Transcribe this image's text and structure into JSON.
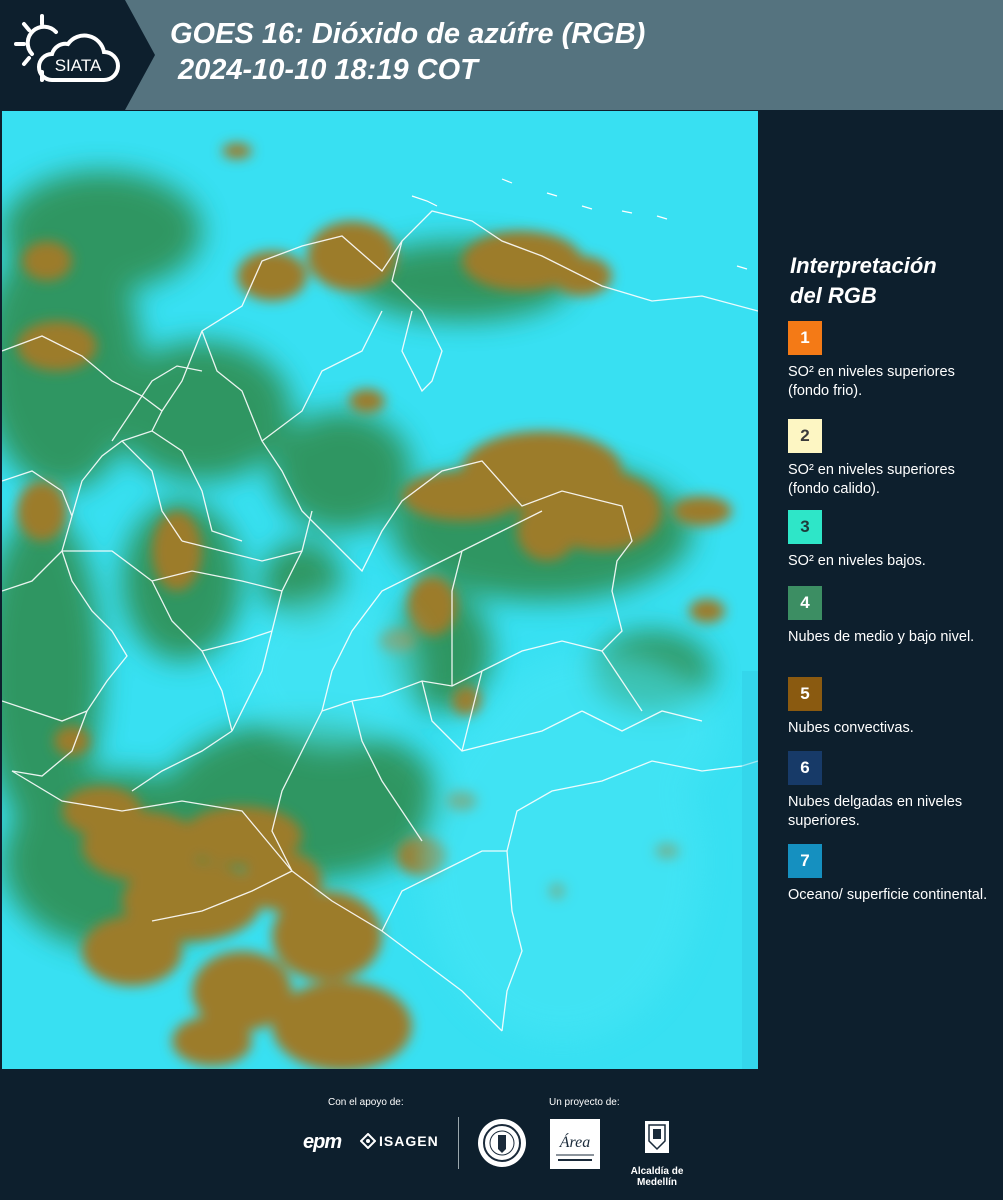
{
  "header": {
    "logo_text": "SIATA",
    "title_line1": "GOES 16: Dióxido de azúfre (RGB)",
    "title_line2": "2024-10-10 18:19 COT"
  },
  "legend": {
    "title_line1": "Interpretación",
    "title_line2": "del RGB",
    "items": [
      {
        "number": "1",
        "color": "#f47a16",
        "text_color": "#ffffff",
        "text": "SO² en niveles superiores (fondo frio)."
      },
      {
        "number": "2",
        "color": "#fdf6c3",
        "text_color": "#3b3b3b",
        "text": "SO² en niveles superiores (fondo calido)."
      },
      {
        "number": "3",
        "color": "#2ee6c8",
        "text_color": "#1d3b3b",
        "text": "SO² en niveles bajos."
      },
      {
        "number": "4",
        "color": "#3c8e63",
        "text_color": "#ffffff",
        "text": "Nubes de medio y bajo nivel."
      },
      {
        "number": "5",
        "color": "#8a5a10",
        "text_color": "#ffffff",
        "text": "Nubes convectivas."
      },
      {
        "number": "6",
        "color": "#173a68",
        "text_color": "#ffffff",
        "text": "Nubes delgadas en niveles superiores."
      },
      {
        "number": "7",
        "color": "#1590c0",
        "text_color": "#ffffff",
        "text": "Oceano/ superficie continental."
      }
    ]
  },
  "footer": {
    "support_label": "Con el apoyo de:",
    "project_label": "Un proyecto de:",
    "sponsor_1": "epm",
    "sponsor_2": "ISAGEN",
    "partner_1": "Área Metropolitana Valle de Aburrá",
    "partner_2": "Alcaldía de Medellín"
  },
  "colors": {
    "map_background": "#35dff2",
    "cloud_convective": "#9a7a2e",
    "cloud_low": "#2e8a3c",
    "header_bar": "#55737f",
    "panel": "#0d1f2d"
  }
}
